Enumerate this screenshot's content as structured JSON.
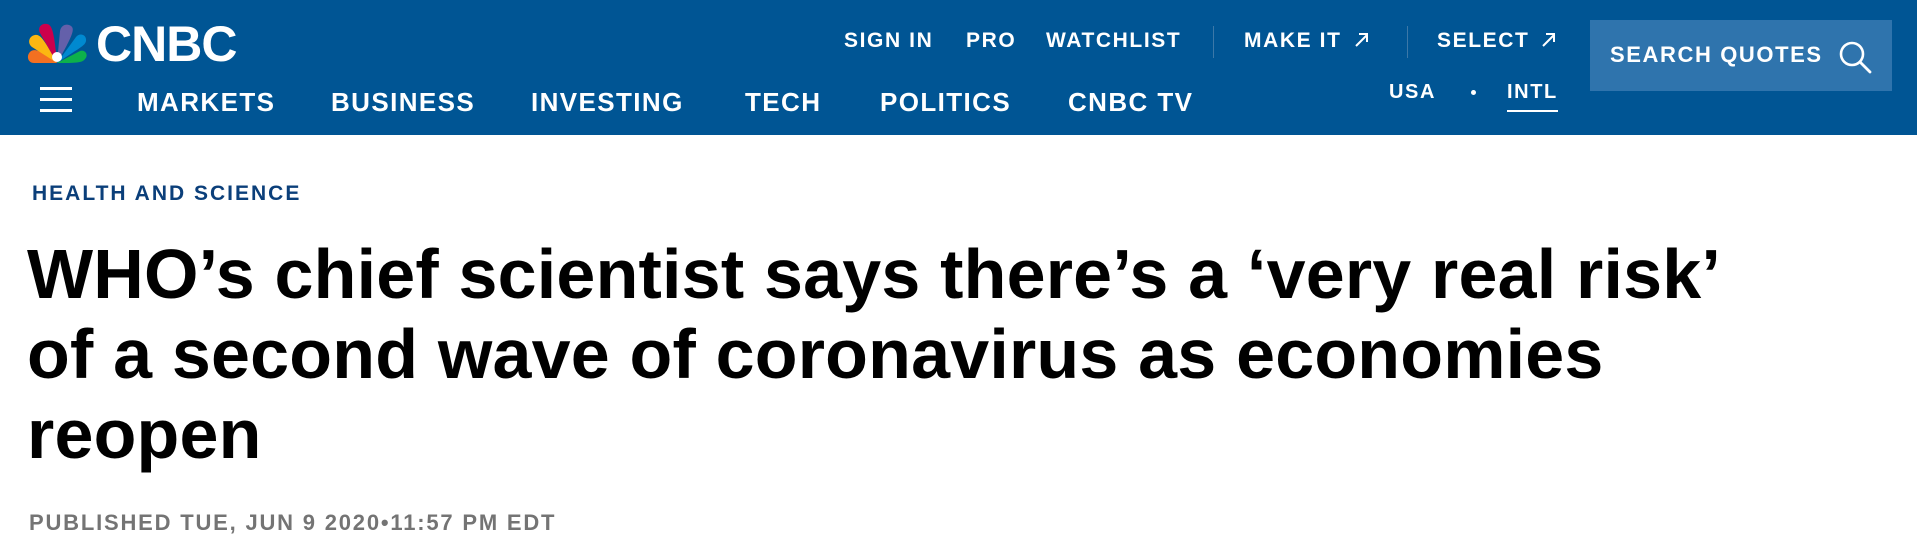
{
  "brand": {
    "logo_text": "CNBC",
    "header_color": "#005594",
    "search_bg": "#2f74ad"
  },
  "top_nav": {
    "sign_in": "SIGN IN",
    "pro": "PRO",
    "watchlist": "WATCHLIST",
    "make_it": "MAKE IT",
    "select": "SELECT"
  },
  "main_nav": {
    "items": [
      "MARKETS",
      "BUSINESS",
      "INVESTING",
      "TECH",
      "POLITICS",
      "CNBC TV"
    ]
  },
  "region": {
    "usa": "USA",
    "intl": "INTL",
    "active": "INTL"
  },
  "search": {
    "label": "SEARCH QUOTES",
    "icon": "search-icon"
  },
  "article": {
    "section": "HEALTH AND SCIENCE",
    "section_color": "#0b3f7a",
    "headline": "WHO’s chief scientist says there’s a ‘very real risk’ of a second wave of coronavirus as economies reopen",
    "published": "PUBLISHED TUE, JUN 9 2020•11:57 PM EDT"
  }
}
